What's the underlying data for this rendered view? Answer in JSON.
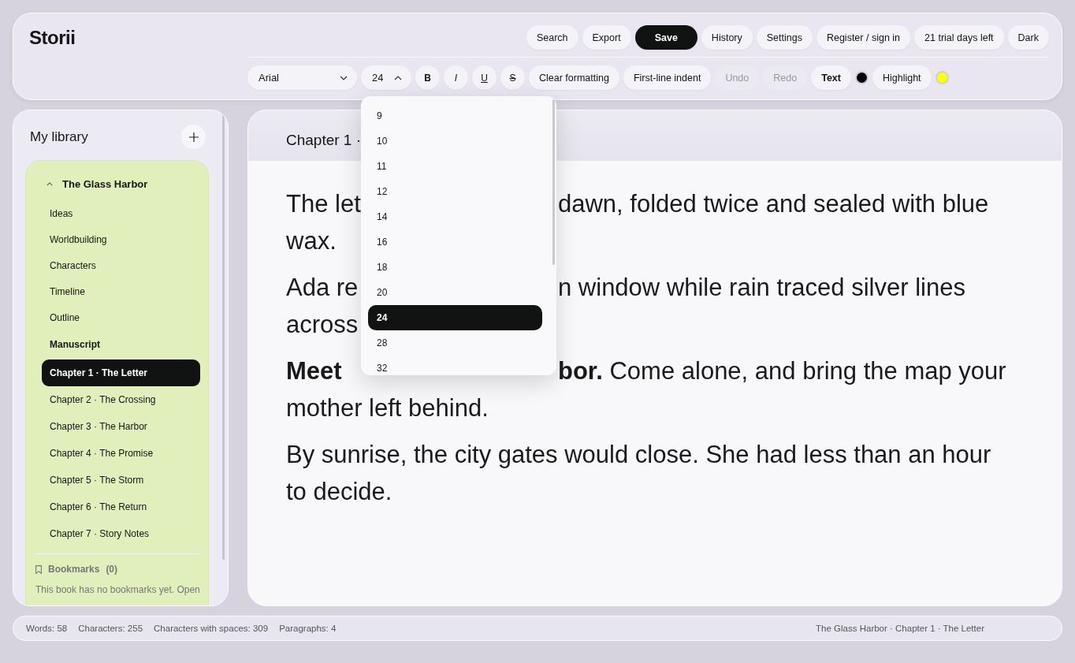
{
  "app": {
    "title": "Storii"
  },
  "header_buttons": [
    {
      "label": "Search",
      "kind": "plain"
    },
    {
      "label": "Export",
      "kind": "plain"
    },
    {
      "label": "Save",
      "kind": "primary"
    },
    {
      "label": "History",
      "kind": "plain"
    },
    {
      "label": "Settings",
      "kind": "plain"
    },
    {
      "label": "Register / sign in",
      "kind": "plain"
    },
    {
      "label": "21 trial days left",
      "kind": "plain"
    },
    {
      "label": "Dark",
      "kind": "plain"
    }
  ],
  "toolbar": {
    "font": {
      "value": "Arial",
      "expanded": false
    },
    "size": {
      "value": "24",
      "expanded": true
    },
    "style_buttons": [
      {
        "label": "B",
        "kind": "bold"
      },
      {
        "label": "I",
        "kind": "italic"
      },
      {
        "label": "U",
        "kind": "underline"
      },
      {
        "label": "S",
        "kind": "strike"
      }
    ],
    "actions": [
      {
        "label": "Clear formatting",
        "disabled": false
      },
      {
        "label": "First-line indent",
        "disabled": false
      },
      {
        "label": "Undo",
        "disabled": true
      },
      {
        "label": "Redo",
        "disabled": true
      }
    ],
    "text_color": {
      "label": "Text",
      "color": "#000000"
    },
    "highlight_color": {
      "label": "Highlight",
      "color": "#ffff00"
    }
  },
  "size_menu": [
    {
      "label": "9",
      "selected": false
    },
    {
      "label": "10",
      "selected": false
    },
    {
      "label": "11",
      "selected": false
    },
    {
      "label": "12",
      "selected": false
    },
    {
      "label": "14",
      "selected": false
    },
    {
      "label": "16",
      "selected": false
    },
    {
      "label": "18",
      "selected": false
    },
    {
      "label": "20",
      "selected": false
    },
    {
      "label": "24",
      "selected": true
    },
    {
      "label": "28",
      "selected": false
    },
    {
      "label": "32",
      "selected": false
    }
  ],
  "sidebar": {
    "title": "My library",
    "book": {
      "title": "The Glass Harbor",
      "expanded": true,
      "notes": [
        {
          "label": "Ideas"
        },
        {
          "label": "Worldbuilding"
        },
        {
          "label": "Characters"
        },
        {
          "label": "Timeline"
        },
        {
          "label": "Outline"
        }
      ],
      "manuscript": {
        "label": "Manuscript",
        "children": [
          {
            "label": "Chapter 1 · The Letter",
            "selected": true
          },
          {
            "label": "Chapter 2 · The Crossing",
            "selected": false
          },
          {
            "label": "Chapter 3 · The Harbor",
            "selected": false
          },
          {
            "label": "Chapter 4 · The Promise",
            "selected": false
          },
          {
            "label": "Chapter 5 · The Storm",
            "selected": false
          },
          {
            "label": "Chapter 6 · The Return",
            "selected": false
          },
          {
            "label": "Chapter 7 · Story Notes",
            "selected": false
          }
        ]
      },
      "bookmarks": {
        "label": "Bookmarks",
        "count": "(0)",
        "note": "This book has no bookmarks yet. Open"
      }
    }
  },
  "editor": {
    "title": "Chapter 1 ·",
    "paragraphs": [
      {
        "lines": [
          {
            "left": "The let",
            "right": "dawn, folded twice and sealed with blue"
          },
          {
            "left": "wax."
          }
        ]
      },
      {
        "lines": [
          {
            "left": "Ada re",
            "right": "n window while rain traced silver lines"
          },
          {
            "left": "across"
          }
        ]
      },
      {
        "lines": [
          {
            "left": "**Meet**",
            "right": "**bor.** Come alone, and bring the map your"
          },
          {
            "left": "mother left behind."
          }
        ]
      },
      {
        "lines": [
          {
            "left": "By sunrise, the city gates would close. She had less than an hour"
          },
          {
            "left": "to decide."
          }
        ]
      }
    ]
  },
  "status_bar": {
    "stats": [
      "Words: 58",
      "Characters: 255",
      "Characters with spaces: 309",
      "Paragraphs: 4"
    ],
    "location": "The Glass Harbor · Chapter 1 · The Letter"
  }
}
